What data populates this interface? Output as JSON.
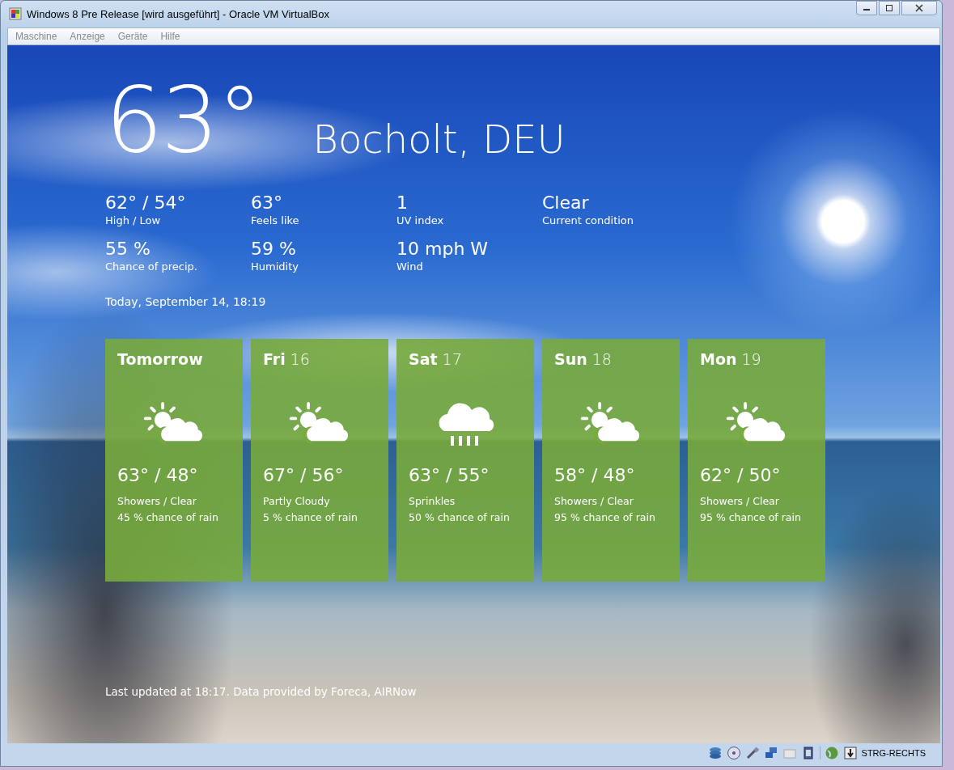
{
  "window": {
    "title": "Windows 8 Pre Release [wird ausgeführt] - Oracle VM VirtualBox"
  },
  "menu": [
    "Maschine",
    "Anzeige",
    "Geräte",
    "Hilfe"
  ],
  "current": {
    "temperature": "63°",
    "location": "Bocholt, DEU",
    "stats": [
      {
        "value": "62° / 54°",
        "label": "High / Low"
      },
      {
        "value": "63°",
        "label": "Feels like"
      },
      {
        "value": "1",
        "label": "UV index"
      },
      {
        "value": "Clear",
        "label": "Current condition"
      },
      {
        "value": "55 %",
        "label": "Chance of precip."
      },
      {
        "value": "59 %",
        "label": "Humidity"
      },
      {
        "value": "10 mph W",
        "label": "Wind"
      }
    ],
    "updated": "Today, September 14, 18:19"
  },
  "forecast": [
    {
      "day": "Tomorrow",
      "kind": "partly-sunny",
      "temps": "63° / 48°",
      "condition": "Showers / Clear",
      "rain": "45 % chance of rain"
    },
    {
      "day": "Fri",
      "date": "16",
      "kind": "partly-sunny",
      "temps": "67° / 56°",
      "condition": "Partly Cloudy",
      "rain": "5 % chance of rain"
    },
    {
      "day": "Sat",
      "date": "17",
      "kind": "rain",
      "temps": "63° / 55°",
      "condition": "Sprinkles",
      "rain": "50 % chance of rain"
    },
    {
      "day": "Sun",
      "date": "18",
      "kind": "partly-sunny",
      "temps": "58° / 48°",
      "condition": "Showers / Clear",
      "rain": "95 % chance of rain"
    },
    {
      "day": "Mon",
      "date": "19",
      "kind": "partly-sunny",
      "temps": "62° / 50°",
      "condition": "Showers / Clear",
      "rain": "95 % chance of rain"
    }
  ],
  "footer": "Last updated at 18:17. Data provided by Foreca, AIRNow",
  "status_bar": {
    "host_key": "STRG-RECHTS"
  }
}
